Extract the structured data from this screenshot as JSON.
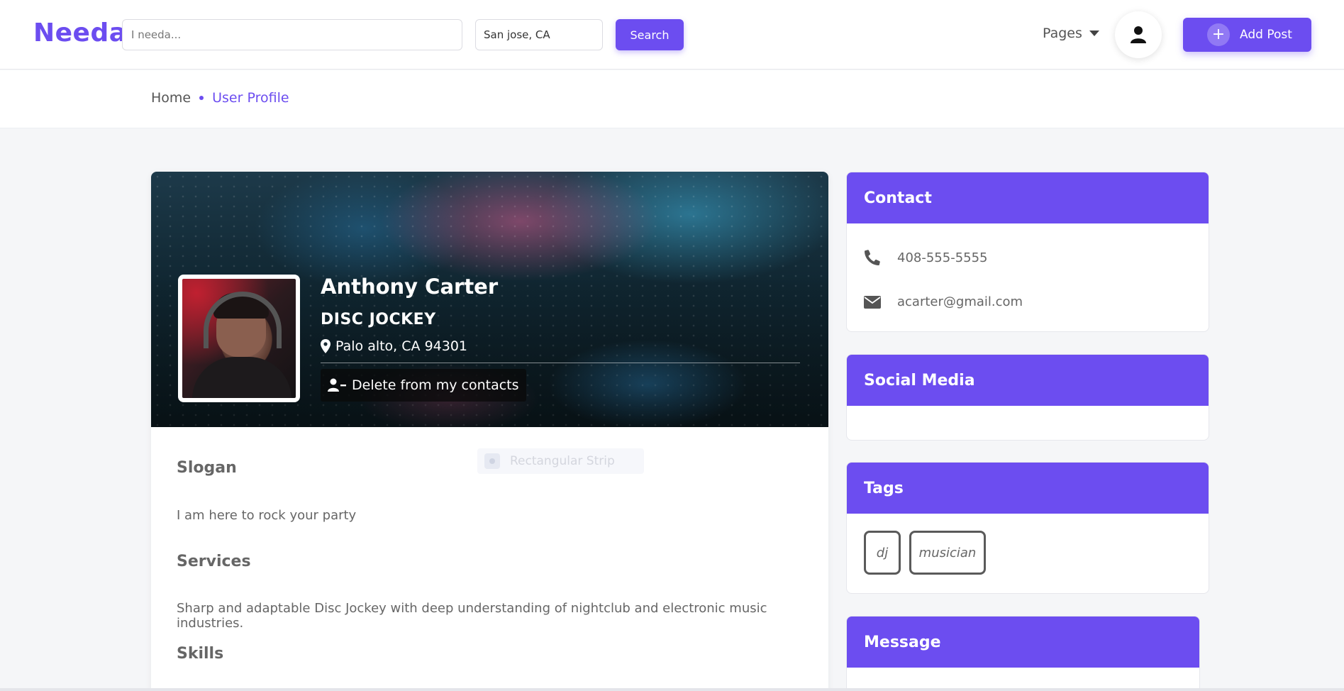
{
  "header": {
    "logo": "Needa",
    "search_placeholder": "I needa...",
    "location_value": "San jose, CA",
    "search_label": "Search",
    "pages_label": "Pages",
    "add_post_label": "Add Post"
  },
  "breadcrumb": {
    "home": "Home",
    "current": "User Profile"
  },
  "profile": {
    "name": "Anthony Carter",
    "title": "DISC JOCKEY",
    "location": "Palo alto, CA 94301",
    "delete_contact_label": "Delete from my contacts",
    "slogan_heading": "Slogan",
    "slogan": "I am here to rock your party",
    "services_heading": "Services",
    "services": "Sharp and adaptable Disc Jockey with deep understanding of nightclub and electronic music industries.",
    "skills_heading": "Skills",
    "ghost_item": "Rectangular Strip"
  },
  "sidebar": {
    "contact": {
      "title": "Contact",
      "phone": "408-555-5555",
      "email": "acarter@gmail.com"
    },
    "social": {
      "title": "Social Media"
    },
    "tags": {
      "title": "Tags",
      "items": [
        "dj",
        "musician"
      ]
    },
    "message": {
      "title": "Message"
    }
  },
  "colors": {
    "accent": "#6c4df0",
    "background": "#f5f6f8",
    "text": "#666666"
  },
  "icons": {
    "user": "user-icon",
    "plus": "plus-icon",
    "pin": "map-pin-icon",
    "remove_user": "user-minus-icon",
    "phone": "phone-icon",
    "envelope": "envelope-icon",
    "caret": "caret-down-icon"
  }
}
